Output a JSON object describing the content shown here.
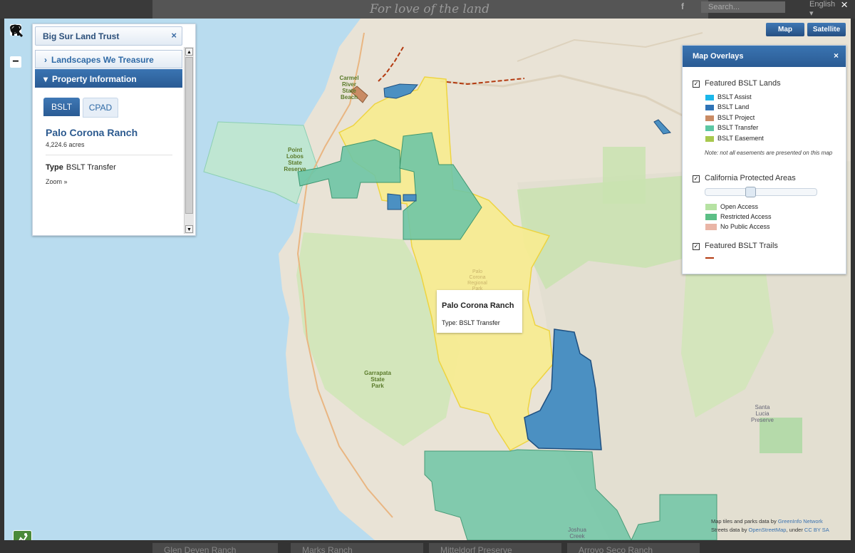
{
  "background_page": {
    "tagline": "For love of the land",
    "facebook_glyph": "f",
    "search_placeholder": "Search...",
    "language": "English ▾",
    "bottom_tiles": [
      "Glen Deven Ranch",
      "Marks Ranch",
      "Mitteldorf Preserve",
      "Arroyo Seco Ranch"
    ],
    "close_label": "×"
  },
  "zoom_controls": {
    "zoom_in": "+",
    "zoom_out": "−"
  },
  "left_panel": {
    "title": "Big Sur Land Trust",
    "close": "×",
    "sections": [
      {
        "label": "Landscapes We Treasure",
        "arrow": "›"
      },
      {
        "label": "Property Information",
        "arrow": "▾"
      }
    ],
    "tabs": [
      "BSLT",
      "CPAD"
    ],
    "property": {
      "name": "Palo Corona Ranch",
      "acres": "4,224.6 acres",
      "type_label": "Type",
      "type_value": "BSLT Transfer",
      "zoom_link": "Zoom »"
    }
  },
  "map_toggle": {
    "map": "Map",
    "satellite": "Satellite"
  },
  "overlays": {
    "title": "Map Overlays",
    "close": "×",
    "featured_lands": {
      "label": "Featured BSLT Lands",
      "checked": true,
      "legend": [
        {
          "label": "BSLT Assist",
          "color": "#1bb7ea"
        },
        {
          "label": "BSLT Land",
          "color": "#2f73b6"
        },
        {
          "label": "BSLT Project",
          "color": "#c98b64"
        },
        {
          "label": "BSLT Transfer",
          "color": "#5cc7a3"
        },
        {
          "label": "BSLT Easement",
          "color": "#a8c84e"
        }
      ],
      "note": "Note: not all easements are presented on this map"
    },
    "protected_areas": {
      "label": "California Protected Areas",
      "checked": true,
      "opacity_fraction": 0.4,
      "legend": [
        {
          "label": "Open Access",
          "color": "#b6e2a3"
        },
        {
          "label": "Restricted Access",
          "color": "#5cbf86"
        },
        {
          "label": "No Public Access",
          "color": "#e9b5a6"
        }
      ]
    },
    "trails": {
      "label": "Featured BSLT Trails",
      "checked": true,
      "color": "#b33a10"
    }
  },
  "popup": {
    "title": "Palo Corona Ranch",
    "subtitle": "Type: BSLT Transfer"
  },
  "map_labels": {
    "carmel_river": [
      "Carmel",
      "River",
      "State",
      "Beach"
    ],
    "point_lobos": [
      "Point",
      "Lobos",
      "State",
      "Reserve"
    ],
    "palo_corona": [
      "Palo",
      "Corona",
      "Regional",
      "Park"
    ],
    "garrapata": [
      "Garrapata",
      "State",
      "Park"
    ],
    "santa_lucia": [
      "Santa",
      "Lucia",
      "Preserve"
    ],
    "joshua_creek": [
      "Joshua",
      "Creek"
    ]
  },
  "attribution": {
    "line1_prefix": "Map tiles and parks data by ",
    "line1_link": "GreenInfo Network",
    "line2_prefix": "Streets data by ",
    "line2_link": "OpenStreetMap",
    "line2_mid": ", under ",
    "line2_link2": "CC BY SA"
  }
}
